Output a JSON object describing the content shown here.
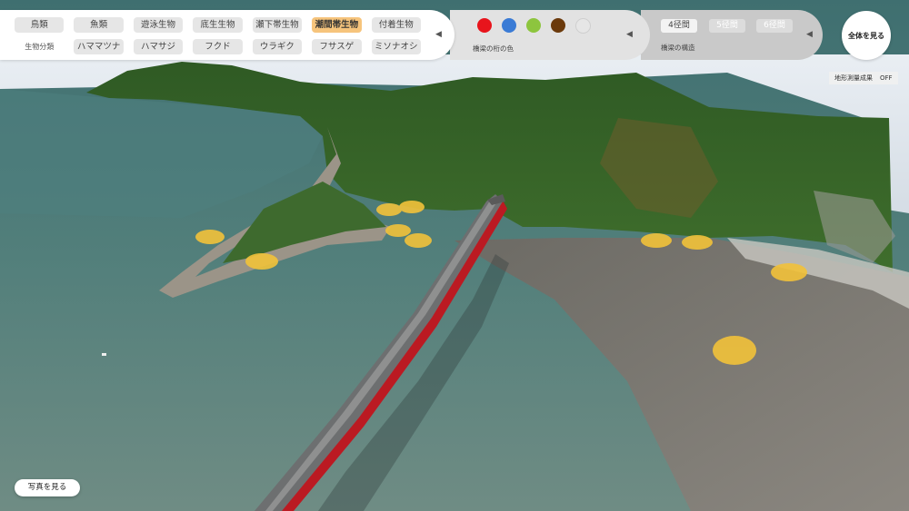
{
  "categories": {
    "row1": [
      "鳥類",
      "魚類",
      "遊泳生物",
      "底生生物",
      "瀬下帯生物",
      "潮間帯生物",
      "付着生物"
    ],
    "active": "潮間帯生物",
    "row2_label": "生物分類",
    "row2": [
      "ハママツナ",
      "ハマサジ",
      "フクド",
      "ウラギク",
      "フサスゲ",
      "ミソナオシ"
    ]
  },
  "colors": {
    "caption": "橋梁の桁の色",
    "swatches": [
      "#e8141c",
      "#3a7bd5",
      "#8dc53e",
      "#6b3a0c",
      "#e6e6e6"
    ]
  },
  "structure": {
    "caption": "橋梁の構造",
    "spans": [
      "4径間",
      "5径間",
      "6径間"
    ],
    "active": "4径間"
  },
  "arrow_glyph": "◀",
  "view_all_label": "全体を見る",
  "survey": {
    "label": "地形測量成果",
    "state": "OFF"
  },
  "photo_label": "写真を見る"
}
